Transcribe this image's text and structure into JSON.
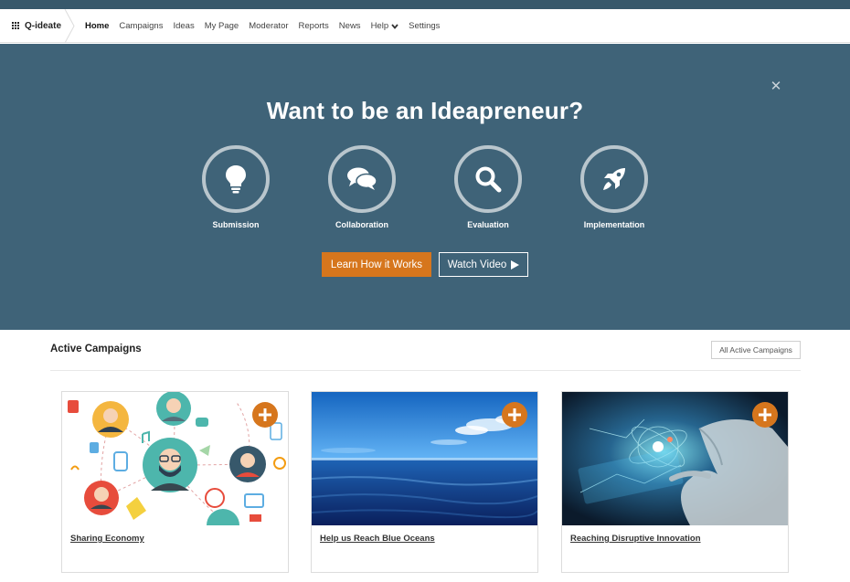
{
  "brand": {
    "name": "Q-ideate"
  },
  "nav": {
    "items": [
      {
        "label": "Home"
      },
      {
        "label": "Campaigns"
      },
      {
        "label": "Ideas"
      },
      {
        "label": "My Page"
      },
      {
        "label": "Moderator"
      },
      {
        "label": "Reports"
      },
      {
        "label": "News"
      },
      {
        "label": "Help"
      },
      {
        "label": "Settings"
      }
    ]
  },
  "hero": {
    "title": "Want to be an Ideapreneur?",
    "steps": [
      {
        "label": "Submission",
        "icon": "lightbulb-icon"
      },
      {
        "label": "Collaboration",
        "icon": "chat-bubbles-icon"
      },
      {
        "label": "Evaluation",
        "icon": "magnifier-icon"
      },
      {
        "label": "Implementation",
        "icon": "rocket-icon"
      }
    ],
    "learn_button": "Learn How it Works",
    "video_button": "Watch Video"
  },
  "campaigns": {
    "heading": "Active Campaigns",
    "all_button": "All Active Campaigns",
    "cards": [
      {
        "title": "Sharing Economy"
      },
      {
        "title": "Help us Reach Blue Oceans"
      },
      {
        "title": "Reaching Disruptive Innovation"
      }
    ]
  },
  "colors": {
    "header_strip": "#37586b",
    "hero_bg": "#3f6378",
    "accent": "#d6761d"
  }
}
